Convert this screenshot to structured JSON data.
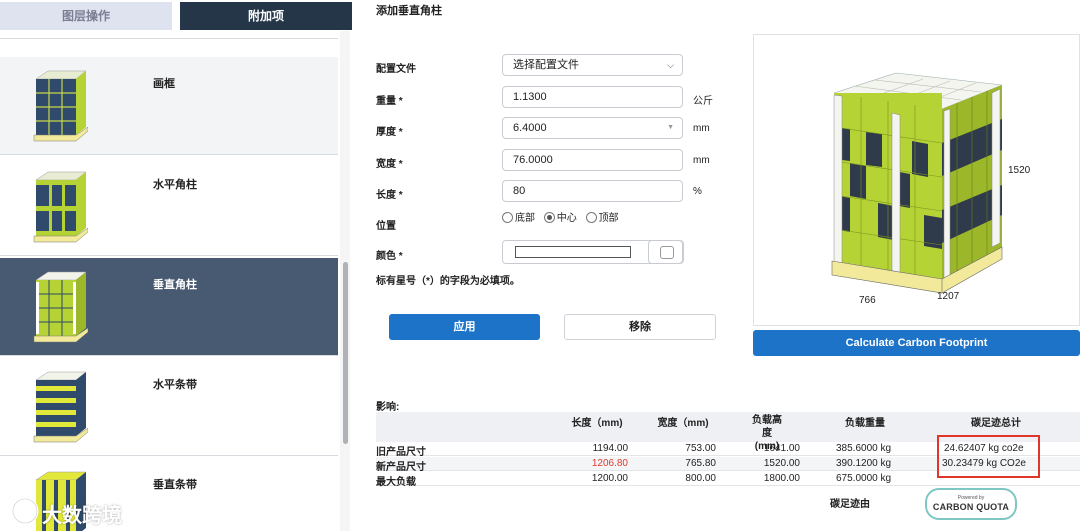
{
  "tabs": {
    "layer_ops": "图层操作",
    "addons": "附加项"
  },
  "list_items": [
    {
      "name": "画框"
    },
    {
      "name": "水平角柱"
    },
    {
      "name": "垂直角柱"
    },
    {
      "name": "水平条带"
    },
    {
      "name": "垂直条带"
    }
  ],
  "watermark": "大数跨境",
  "form": {
    "title": "添加垂直角柱",
    "profile_label": "配置文件",
    "profile_value": "选择配置文件",
    "weight_label": "重量 *",
    "weight_value": "1.1300",
    "weight_unit": "公斤",
    "thickness_label": "厚度 *",
    "thickness_value": "6.4000",
    "thickness_unit": "mm",
    "width_label": "宽度 *",
    "width_value": "76.0000",
    "width_unit": "mm",
    "length_label": "长度 *",
    "length_value": "80",
    "length_unit": "%",
    "position_label": "位置",
    "position_options": [
      "底部",
      "中心",
      "顶部"
    ],
    "position_selected": "中心",
    "color_label": "颜色 *",
    "required_note": "标有星号（*）的字段为必填项。",
    "apply_button": "应用",
    "remove_button": "移除"
  },
  "preview": {
    "height_dim": "1520",
    "depth_dim": "766",
    "width_dim": "1207",
    "box_color": "#b5d334",
    "dark_box_color": "#2f3a4a",
    "pallet_color": "#f2ea9a"
  },
  "carbon_button": "Calculate Carbon Footprint",
  "impact": {
    "title": "影响:",
    "headers": [
      "长度（mm)",
      "宽度（mm)",
      "负载高度 (mm)",
      "负载重量",
      "碳足迹总计"
    ],
    "rows": [
      {
        "label": "旧产品尺寸",
        "length": "1194.00",
        "width": "753.00",
        "height": "1641.00",
        "weight": "385.6000 kg",
        "co2": "24.62407 kg co2e"
      },
      {
        "label": "新产品尺寸",
        "length": "1206.80",
        "width": "765.80",
        "height": "1520.00",
        "weight": "390.1200 kg",
        "co2": "30.23479 kg CO2e"
      },
      {
        "label": "最大负载",
        "length": "1200.00",
        "width": "800.00",
        "height": "1800.00",
        "weight": "675.0000 kg",
        "co2": ""
      }
    ],
    "source_label": "碳足迹由",
    "badge_small": "Powered by",
    "badge_big": "CARBON QUOTA"
  }
}
